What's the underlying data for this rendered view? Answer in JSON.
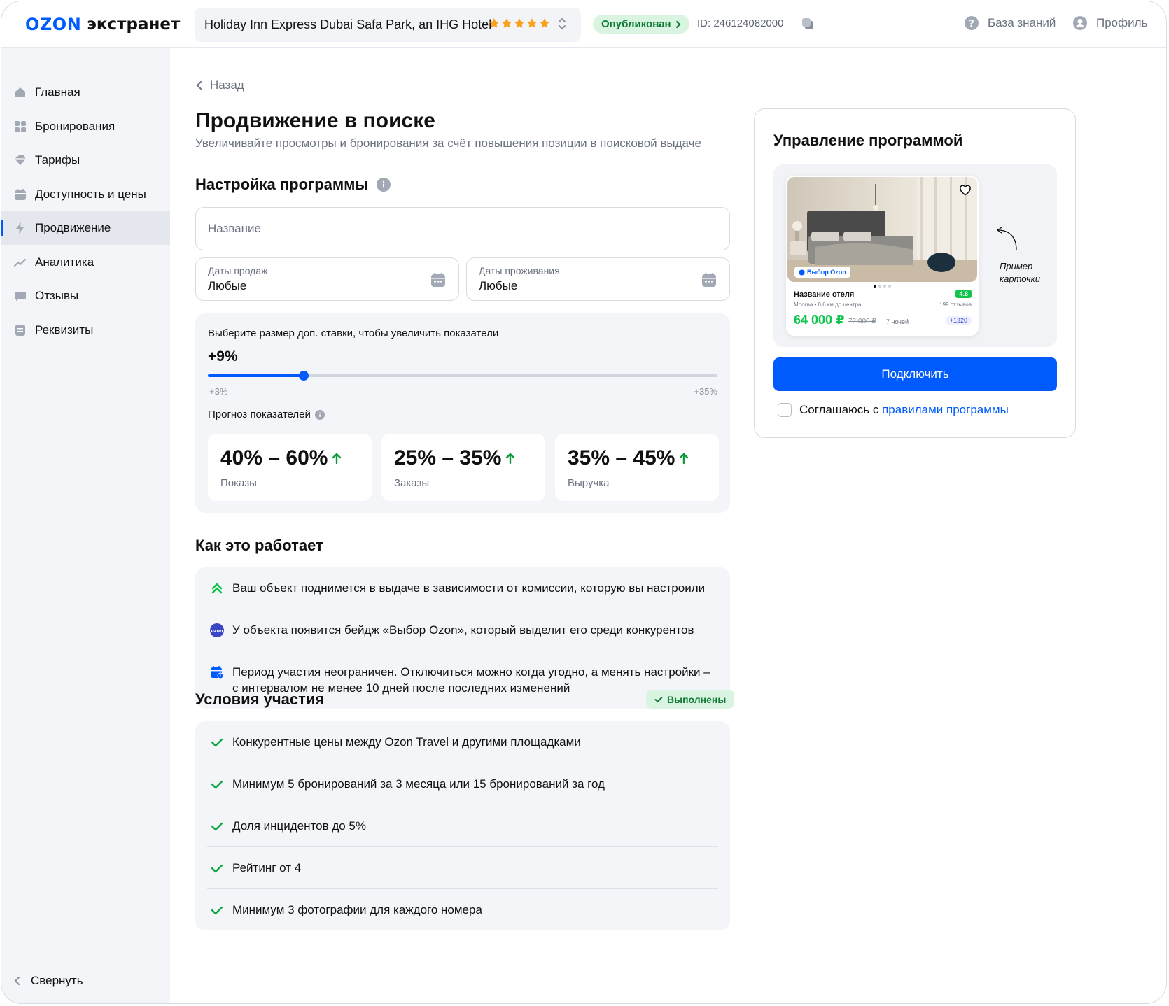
{
  "brand": {
    "logo_mark": "OZON",
    "logo_text": "экстранет"
  },
  "header": {
    "hotel_name": "Holiday Inn Express Dubai Safa Park, an IHG Hotel",
    "hotel_stars": 5,
    "status": "Опубликован",
    "hotel_id": "ID: 246124082000",
    "knowledge_base": "База знаний",
    "profile": "Профиль"
  },
  "sidebar": {
    "items": [
      {
        "label": "Главная",
        "icon": "home-icon",
        "active": false
      },
      {
        "label": "Бронирования",
        "icon": "grid-icon",
        "active": false
      },
      {
        "label": "Тарифы",
        "icon": "tag-icon",
        "active": false
      },
      {
        "label": "Доступность и цены",
        "icon": "calendar-icon",
        "active": false
      },
      {
        "label": "Продвижение",
        "icon": "lightning-icon",
        "active": true
      },
      {
        "label": "Аналитика",
        "icon": "chart-line-icon",
        "active": false
      },
      {
        "label": "Отзывы",
        "icon": "chat-icon",
        "active": false
      },
      {
        "label": "Реквизиты",
        "icon": "document-icon",
        "active": false
      }
    ],
    "collapse_label": "Свернуть"
  },
  "page": {
    "back_label": "Назад",
    "title": "Продвижение в поиске",
    "subtitle": "Увеличивайте просмотры и бронирования за счёт повышения позиции в поисковой выдаче"
  },
  "settings": {
    "title": "Настройка программы",
    "name_placeholder": "Название",
    "sales_dates_label": "Даты продаж",
    "sales_dates_value": "Любые",
    "stay_dates_label": "Даты проживания",
    "stay_dates_value": "Любые",
    "rate_hint": "Выберите размер доп. ставки, чтобы увеличить показатели",
    "rate_value": "+9%",
    "rate_min": "+3%",
    "rate_max": "+35%",
    "rate_fraction": 0.1875,
    "forecast_label": "Прогноз показателей",
    "stats": [
      {
        "value": "40% – 60%",
        "label": "Показы"
      },
      {
        "value": "25% – 35%",
        "label": "Заказы"
      },
      {
        "value": "35% – 45%",
        "label": "Выручка"
      }
    ]
  },
  "how_it_works": {
    "title": "Как это работает",
    "items": [
      {
        "icon": "double-chevron-up-icon",
        "text": "Ваш объект поднимется в выдаче в зависимости от комиссии, которую вы настроили"
      },
      {
        "icon": "ozon-badge-icon",
        "text": "У объекта появится бейдж «Выбор Ozon», который выделит его среди конкурентов"
      },
      {
        "icon": "calendar-clock-icon",
        "text": "Период участия неограничен. Отключиться можно когда угодно, а менять настройки – с интервалом не менее 10 дней после последних изменений"
      }
    ]
  },
  "conditions": {
    "title": "Условия участия",
    "badge": "Выполнены",
    "items": [
      "Конкурентные цены между Ozon Travel и другими площадками",
      "Минимум 5 бронирований за 3 месяца или 15 бронирований за год",
      "Доля инцидентов до 5%",
      "Рейтинг от 4",
      "Минимум 3 фотографии для каждого номера"
    ]
  },
  "program": {
    "title": "Управление программой",
    "sample_card": {
      "badge": "Выбор Ozon",
      "name": "Название отеля",
      "rating": "4.8",
      "location": "Москва • 0.6 км до центра",
      "reviews": "199 отзывов",
      "price": "64 000 ₽",
      "old_price": "72 000 ₽",
      "nights": "7 ночей",
      "bonus": "+1320"
    },
    "sample_label_1": "Пример",
    "sample_label_2": "карточки",
    "connect_button": "Подключить",
    "agree_prefix": "Соглашаюсь с",
    "agree_link": "правилами программы"
  },
  "colors": {
    "accent": "#005bff",
    "success": "#0f7a35",
    "success_bg": "#d9f5e1",
    "sidebar_bg": "#f3f5f8",
    "price_green": "#10c44c"
  }
}
